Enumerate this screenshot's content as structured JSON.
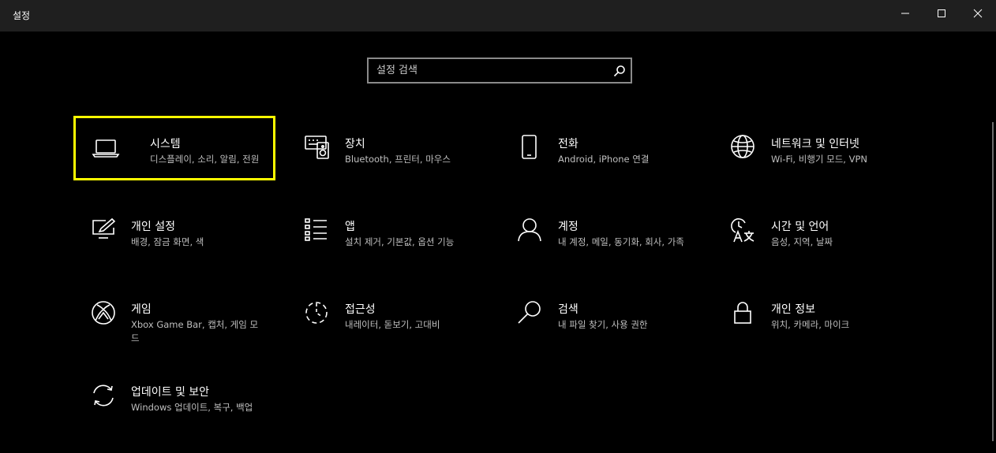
{
  "window": {
    "title": "설정",
    "controls": [
      "minimize",
      "maximize",
      "close"
    ]
  },
  "search": {
    "placeholder": "설정 검색",
    "icon": "search-icon"
  },
  "tiles": [
    {
      "id": "system",
      "title": "시스템",
      "desc": "디스플레이, 소리, 알림, 전원",
      "icon": "laptop-icon",
      "selected": true
    },
    {
      "id": "devices",
      "title": "장치",
      "desc": "Bluetooth, 프린터, 마우스",
      "icon": "keyboard-speaker-icon"
    },
    {
      "id": "phone",
      "title": "전화",
      "desc": "Android, iPhone 연결",
      "icon": "phone-icon"
    },
    {
      "id": "network",
      "title": "네트워크 및 인터넷",
      "desc": "Wi-Fi, 비행기 모드, VPN",
      "icon": "globe-icon"
    },
    {
      "id": "personalization",
      "title": "개인 설정",
      "desc": "배경, 잠금 화면, 색",
      "icon": "paint-monitor-icon"
    },
    {
      "id": "apps",
      "title": "앱",
      "desc": "설치 제거, 기본값, 옵션 기능",
      "icon": "app-list-icon"
    },
    {
      "id": "accounts",
      "title": "계정",
      "desc": "내 계정, 메일, 동기화, 회사, 가족",
      "icon": "person-icon"
    },
    {
      "id": "time",
      "title": "시간 및 언어",
      "desc": "음성, 지역, 날짜",
      "icon": "clock-language-icon"
    },
    {
      "id": "gaming",
      "title": "게임",
      "desc": "Xbox Game Bar, 캡처, 게임 모드",
      "icon": "xbox-icon"
    },
    {
      "id": "ease",
      "title": "접근성",
      "desc": "내레이터, 돋보기, 고대비",
      "icon": "ease-of-access-icon"
    },
    {
      "id": "searchcat",
      "title": "검색",
      "desc": "내 파일 찾기, 사용 권한",
      "icon": "magnifier-icon"
    },
    {
      "id": "privacy",
      "title": "개인 정보",
      "desc": "위치, 카메라, 마이크",
      "icon": "lock-icon"
    },
    {
      "id": "update",
      "title": "업데이트 및 보안",
      "desc": "Windows 업데이트, 복구, 백업",
      "icon": "sync-icon"
    }
  ],
  "colors": {
    "background": "#000000",
    "titlebar": "#1f1f1f",
    "selection": "#ffff00",
    "secondary_text": "#bfbfbf"
  }
}
